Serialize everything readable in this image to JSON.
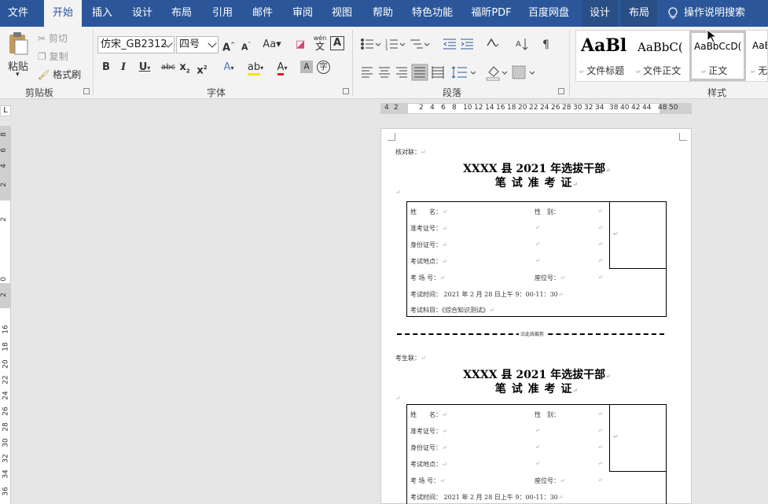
{
  "tabs": {
    "file": "文件",
    "home": "开始",
    "insert": "插入",
    "design": "设计",
    "layout": "布局",
    "references": "引用",
    "mailings": "邮件",
    "review": "审阅",
    "view": "视图",
    "help": "帮助",
    "special": "特色功能",
    "foxit": "福昕PDF",
    "baidu": "百度网盘",
    "table_design": "设计",
    "table_layout": "布局"
  },
  "tellme": "操作说明搜索",
  "clipboard": {
    "paste": "粘贴",
    "cut": "剪切",
    "copy": "复制",
    "format_painter": "格式刷",
    "group": "剪贴板"
  },
  "font": {
    "name": "仿宋_GB2312",
    "size": "四号",
    "group": "字体",
    "change_case": "Aa",
    "phonetic_top": "wén",
    "phonetic_bottom": "文",
    "enclose": "字"
  },
  "paragraph": {
    "group": "段落"
  },
  "styles": {
    "group": "样式",
    "items": [
      {
        "sample": "AaBl",
        "name": "文件标题"
      },
      {
        "sample": "AaBbC(",
        "name": "文件正文"
      },
      {
        "sample": "AaBbCcD(",
        "name": "正文"
      },
      {
        "sample": "AaB",
        "name": "无"
      }
    ]
  },
  "ruler": {
    "h": [
      "4",
      "2",
      "2",
      "4",
      "6",
      "8",
      "10",
      "12",
      "14",
      "16",
      "18",
      "20",
      "22",
      "24",
      "26",
      "28",
      "30",
      "32",
      "34",
      "38",
      "40",
      "42",
      "44",
      "48",
      "50"
    ],
    "v": [
      "8",
      "6",
      "4",
      "2",
      "2",
      "0",
      "2",
      "16",
      "18",
      "20",
      "22",
      "24",
      "26",
      "28",
      "30",
      "32",
      "34",
      "36"
    ]
  },
  "doc": {
    "stub1": "核对联：",
    "stub2": "考生联：",
    "title1": "XXXX 县 2021 年选拔干部",
    "title2": "笔 试 准 考 证",
    "cut_label": "沿此线裁剪",
    "fields": {
      "name": "姓　　名：",
      "gender": "性　别：",
      "ticket": "准考证号：",
      "id": "身份证号：",
      "site": "考试地点：",
      "room": "考 场 号：",
      "seat": "座位号：",
      "time": "考试时间：  2021 年 2 月 28 日上午 9：00-11：30",
      "subject": "考试科目：《综合知识测试》"
    },
    "para_mark": "↵"
  }
}
